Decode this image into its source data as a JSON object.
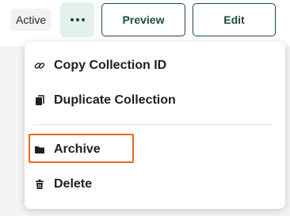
{
  "header": {
    "status": "Active",
    "preview_label": "Preview",
    "edit_label": "Edit",
    "more_icon": "more-horizontal-icon"
  },
  "menu": {
    "items": [
      {
        "label": "Copy Collection ID",
        "icon": "link-icon"
      },
      {
        "label": "Duplicate Collection",
        "icon": "copy-icon"
      },
      {
        "label": "Archive",
        "icon": "folder-icon"
      },
      {
        "label": "Delete",
        "icon": "trash-icon"
      }
    ]
  },
  "colors": {
    "accent": "#1e4d3a",
    "highlight": "#e36a1c",
    "more_button_bg": "#e4f0ea"
  }
}
